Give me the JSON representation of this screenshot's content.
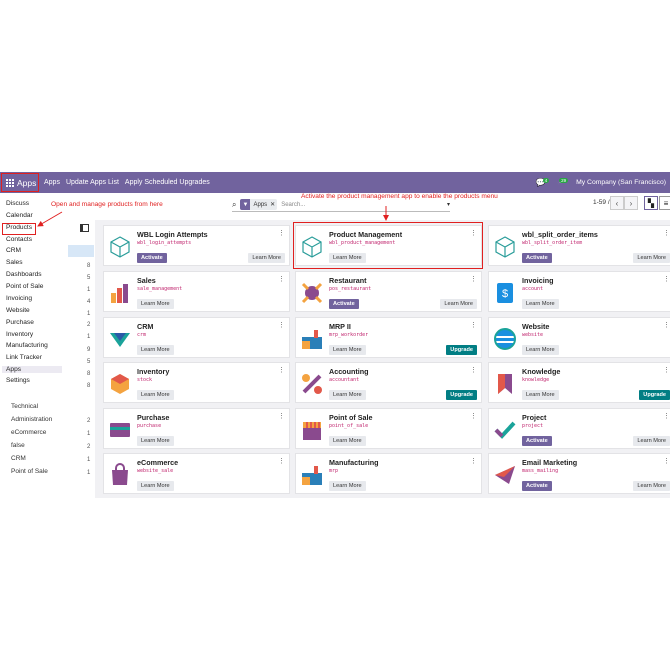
{
  "navbar": {
    "apps_label": "Apps",
    "menu": [
      "Apps",
      "Update Apps List",
      "Apply Scheduled Upgrades"
    ],
    "chat_count": "4",
    "activity_count": "29",
    "company": "My Company (San Francisco)"
  },
  "search": {
    "facet_label": "Apps",
    "placeholder": "Search..."
  },
  "pager": {
    "text": "1-59 / 59"
  },
  "left_menu": {
    "items": [
      "Discuss",
      "Calendar",
      "Products",
      "Contacts",
      "CRM",
      "Sales",
      "Dashboards",
      "Point of Sale",
      "Invoicing",
      "Website",
      "Purchase",
      "Inventory",
      "Manufacturing",
      "Link Tracker",
      "Apps",
      "Settings"
    ],
    "counts": [
      "8",
      "5",
      "1",
      "4",
      "1",
      "2",
      "1",
      "9",
      "5",
      "8",
      "8"
    ],
    "categories": [
      "Technical",
      "Administration",
      "eCommerce",
      "false",
      "CRM",
      "Point of Sale"
    ],
    "category_counts": [
      "2",
      "1",
      "2",
      "1",
      "1"
    ]
  },
  "annotations": {
    "open_products": "Open and manage products from here",
    "activate_app": "Activate the product management app to enable the products menu"
  },
  "apps": [
    {
      "name": "WBL Login Attempts",
      "tech": "wbl_login_attempts",
      "buttons": [
        "Activate",
        "Learn More"
      ],
      "icon": "cube-outline-icon"
    },
    {
      "name": "Product Management",
      "tech": "wbl_product_management",
      "buttons": [
        "Learn More"
      ],
      "icon": "cube-outline-icon"
    },
    {
      "name": "wbl_split_order_items",
      "tech": "wbl_split_order_item",
      "buttons": [
        "Activate",
        "Learn More"
      ],
      "icon": "cube-outline-icon"
    },
    {
      "name": "Sales",
      "tech": "sale_management",
      "buttons": [
        "Learn More"
      ],
      "icon": "sales-chart-icon"
    },
    {
      "name": "Restaurant",
      "tech": "pos_restaurant",
      "buttons": [
        "Activate",
        "Learn More"
      ],
      "icon": "restaurant-icon"
    },
    {
      "name": "Invoicing",
      "tech": "account",
      "buttons": [
        "Learn More"
      ],
      "icon": "invoice-dollar-icon"
    },
    {
      "name": "CRM",
      "tech": "crm",
      "buttons": [
        "Learn More"
      ],
      "icon": "crm-icon"
    },
    {
      "name": "MRP II",
      "tech": "mrp_workorder",
      "buttons": [
        "Learn More",
        "Upgrade"
      ],
      "icon": "factory-icon"
    },
    {
      "name": "Website",
      "tech": "website",
      "buttons": [
        "Learn More"
      ],
      "icon": "website-icon"
    },
    {
      "name": "Inventory",
      "tech": "stock",
      "buttons": [
        "Learn More"
      ],
      "icon": "inventory-box-icon"
    },
    {
      "name": "Accounting",
      "tech": "accountant",
      "buttons": [
        "Learn More",
        "Upgrade"
      ],
      "icon": "accounting-icon"
    },
    {
      "name": "Knowledge",
      "tech": "knowledge",
      "buttons": [
        "Learn More",
        "Upgrade"
      ],
      "icon": "bookmark-icon"
    },
    {
      "name": "Purchase",
      "tech": "purchase",
      "buttons": [
        "Learn More"
      ],
      "icon": "purchase-card-icon"
    },
    {
      "name": "Point of Sale",
      "tech": "point_of_sale",
      "buttons": [
        "Learn More"
      ],
      "icon": "shop-awning-icon"
    },
    {
      "name": "Project",
      "tech": "project",
      "buttons": [
        "Activate",
        "Learn More"
      ],
      "icon": "checkmark-icon"
    },
    {
      "name": "eCommerce",
      "tech": "website_sale",
      "buttons": [
        "Learn More"
      ],
      "icon": "shopping-bag-icon"
    },
    {
      "name": "Manufacturing",
      "tech": "mrp",
      "buttons": [
        "Learn More"
      ],
      "icon": "factory-icon"
    },
    {
      "name": "Email Marketing",
      "tech": "mass_mailing",
      "buttons": [
        "Activate",
        "Learn More"
      ],
      "icon": "email-send-icon"
    }
  ],
  "colors": {
    "brand": "#71639e",
    "upgrade": "#017e84",
    "annotation": "#e02020",
    "tech_name": "#c0246d"
  }
}
